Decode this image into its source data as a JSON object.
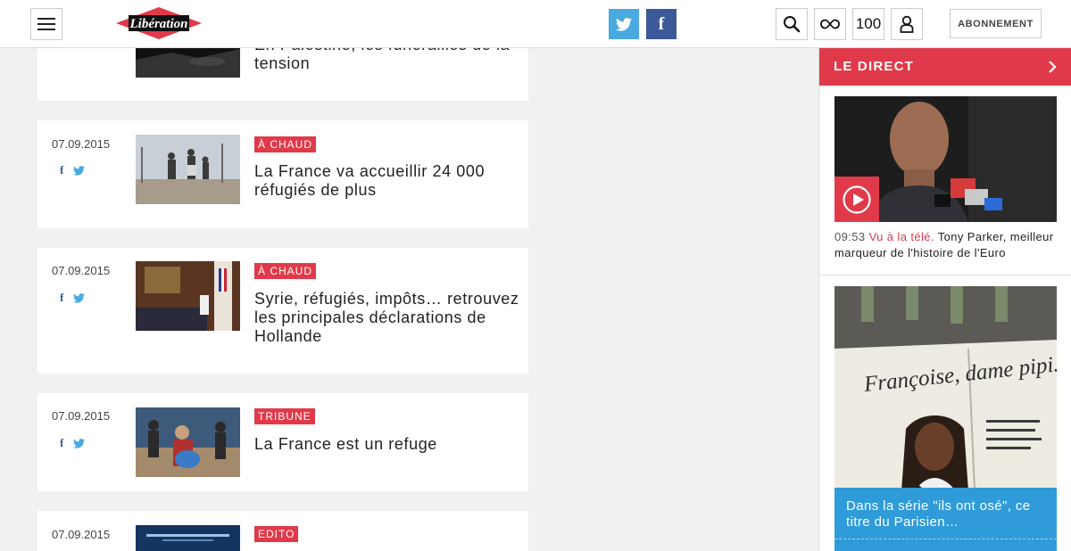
{
  "header": {
    "logo_text": "Libération",
    "search_icon": "search-icon",
    "loop_icon": "infinity-icon",
    "hundred_label": "100",
    "user_icon": "user-icon",
    "subscribe_label": "ABONNEMENT"
  },
  "colors": {
    "accent": "#e03a4a",
    "twitter": "#4aa9e0",
    "facebook": "#3b5998",
    "promo": "#2f9bd8"
  },
  "cards": [
    {
      "title": "En Palestine, les funérailles de la tension"
    },
    {
      "date": "07.09.2015",
      "tag": "À CHAUD",
      "title": "La France va accueillir 24 000 réfugiés de plus"
    },
    {
      "date": "07.09.2015",
      "tag": "À CHAUD",
      "title": "Syrie, réfugiés, impôts… retrouvez les principales déclarations de Hollande"
    },
    {
      "date": "07.09.2015",
      "tag": "TRIBUNE",
      "title": "La France est un refuge"
    },
    {
      "date": "07.09.2015",
      "tag": "EDITO"
    }
  ],
  "sidebar": {
    "direct_label": "LE DIRECT",
    "live": {
      "time": "09:53",
      "kicker": "Vu à la télé.",
      "headline": "Tony Parker, meilleur marqueur de l'histoire de l'Euro"
    },
    "promo": {
      "caption": "Dans la série \"ils ont osé\", ce titre du Parisien…",
      "newspaper_headline": "Françoise, dame pipi… au bout du rouleau"
    }
  }
}
